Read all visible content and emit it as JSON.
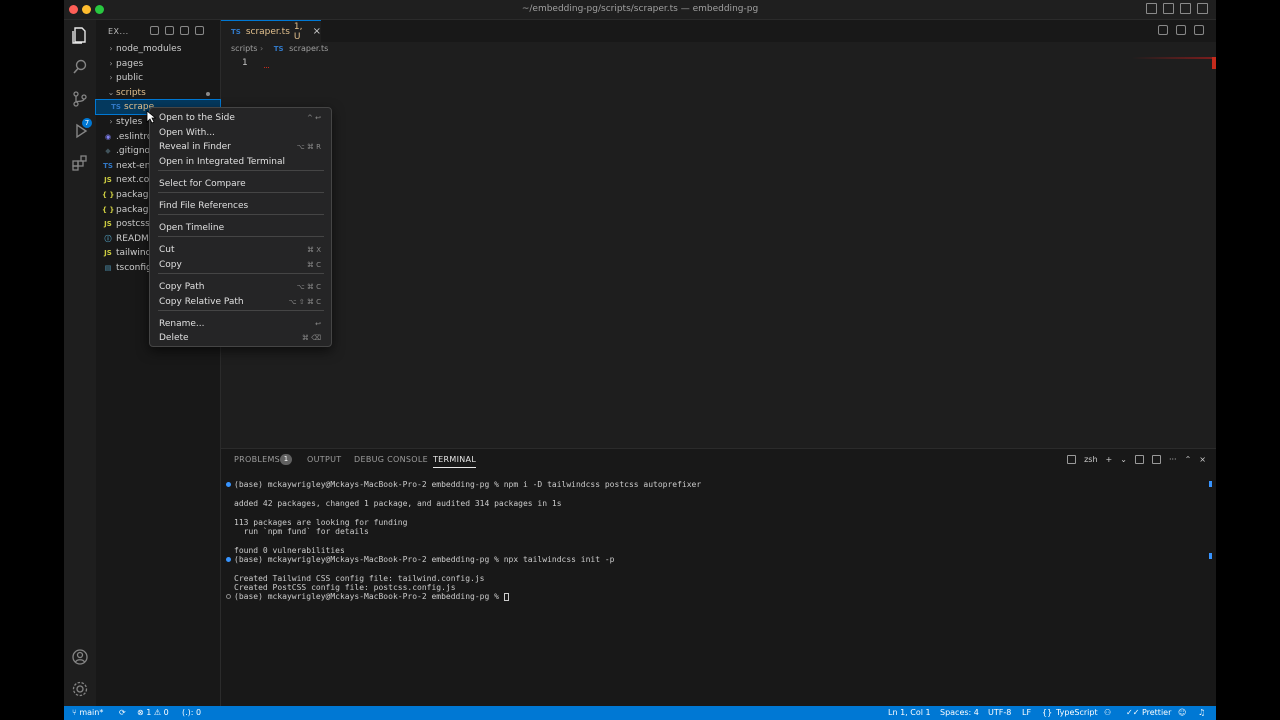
{
  "window": {
    "title": "~/embedding-pg/scripts/scraper.ts — embedding-pg"
  },
  "sidebar": {
    "header": "EX...",
    "items": [
      {
        "label": "node_modules",
        "kind": "folder"
      },
      {
        "label": "pages",
        "kind": "folder"
      },
      {
        "label": "public",
        "kind": "folder"
      },
      {
        "label": "scripts",
        "kind": "folder-open"
      },
      {
        "label": "scrape",
        "kind": "ts"
      },
      {
        "label": "styles",
        "kind": "folder"
      },
      {
        "label": ".eslintrc",
        "kind": "eslint"
      },
      {
        "label": ".gitigno",
        "kind": "git"
      },
      {
        "label": "next-en",
        "kind": "ts"
      },
      {
        "label": "next.co",
        "kind": "js"
      },
      {
        "label": "package",
        "kind": "json"
      },
      {
        "label": "package",
        "kind": "json"
      },
      {
        "label": "postcss",
        "kind": "js"
      },
      {
        "label": "README",
        "kind": "info"
      },
      {
        "label": "tailwind",
        "kind": "js"
      },
      {
        "label": "tsconfig",
        "kind": "tsconfig"
      }
    ]
  },
  "editor": {
    "tab_label": "scraper.ts",
    "tab_status": "1, U",
    "tab_icon": "TS",
    "breadcrumb_folder": "scripts",
    "breadcrumb_file": "scraper.ts",
    "line_number": "1"
  },
  "context_menu": {
    "items": [
      {
        "label": "Open to the Side",
        "shortcut": "^ ↩"
      },
      {
        "label": "Open With...",
        "shortcut": ""
      },
      {
        "label": "Reveal in Finder",
        "shortcut": "⌥ ⌘ R"
      },
      {
        "label": "Open in Integrated Terminal",
        "shortcut": ""
      },
      {
        "label": "Select for Compare",
        "shortcut": ""
      },
      {
        "label": "Find File References",
        "shortcut": ""
      },
      {
        "label": "Open Timeline",
        "shortcut": ""
      },
      {
        "label": "Cut",
        "shortcut": "⌘ X"
      },
      {
        "label": "Copy",
        "shortcut": "⌘ C"
      },
      {
        "label": "Copy Path",
        "shortcut": "⌥ ⌘ C"
      },
      {
        "label": "Copy Relative Path",
        "shortcut": "⌥ ⇧ ⌘ C"
      },
      {
        "label": "Rename...",
        "shortcut": "↩"
      },
      {
        "label": "Delete",
        "shortcut": "⌘ ⌫"
      }
    ]
  },
  "panel": {
    "tabs": [
      "PROBLEMS",
      "OUTPUT",
      "DEBUG CONSOLE",
      "TERMINAL"
    ],
    "problems_count": "1",
    "shell": "zsh",
    "terminal_lines": [
      "(base) mckaywrigley@Mckays-MacBook-Pro-2 embedding-pg % npm i -D tailwindcss postcss autoprefixer",
      "added 42 packages, changed 1 package, and audited 314 packages in 1s",
      "113 packages are looking for funding",
      "  run `npm fund` for details",
      "found 0 vulnerabilities",
      "(base) mckaywrigley@Mckays-MacBook-Pro-2 embedding-pg % npx tailwindcss init -p",
      "Created Tailwind CSS config file: tailwind.config.js",
      "Created PostCSS config file: postcss.config.js",
      "(base) mckaywrigley@Mckays-MacBook-Pro-2 embedding-pg % "
    ]
  },
  "statusbar": {
    "branch": "main*",
    "problems": "⊗ 1 ⚠ 0",
    "ports": "(.): 0",
    "position": "Ln 1, Col 1",
    "spaces": "Spaces: 4",
    "encoding": "UTF-8",
    "eol": "LF",
    "language": "TypeScript",
    "formatter": "Prettier"
  },
  "colors": {
    "accent": "#0078d4",
    "close": "#ff5f57",
    "minimize": "#febc2e",
    "maximize": "#28c840"
  }
}
